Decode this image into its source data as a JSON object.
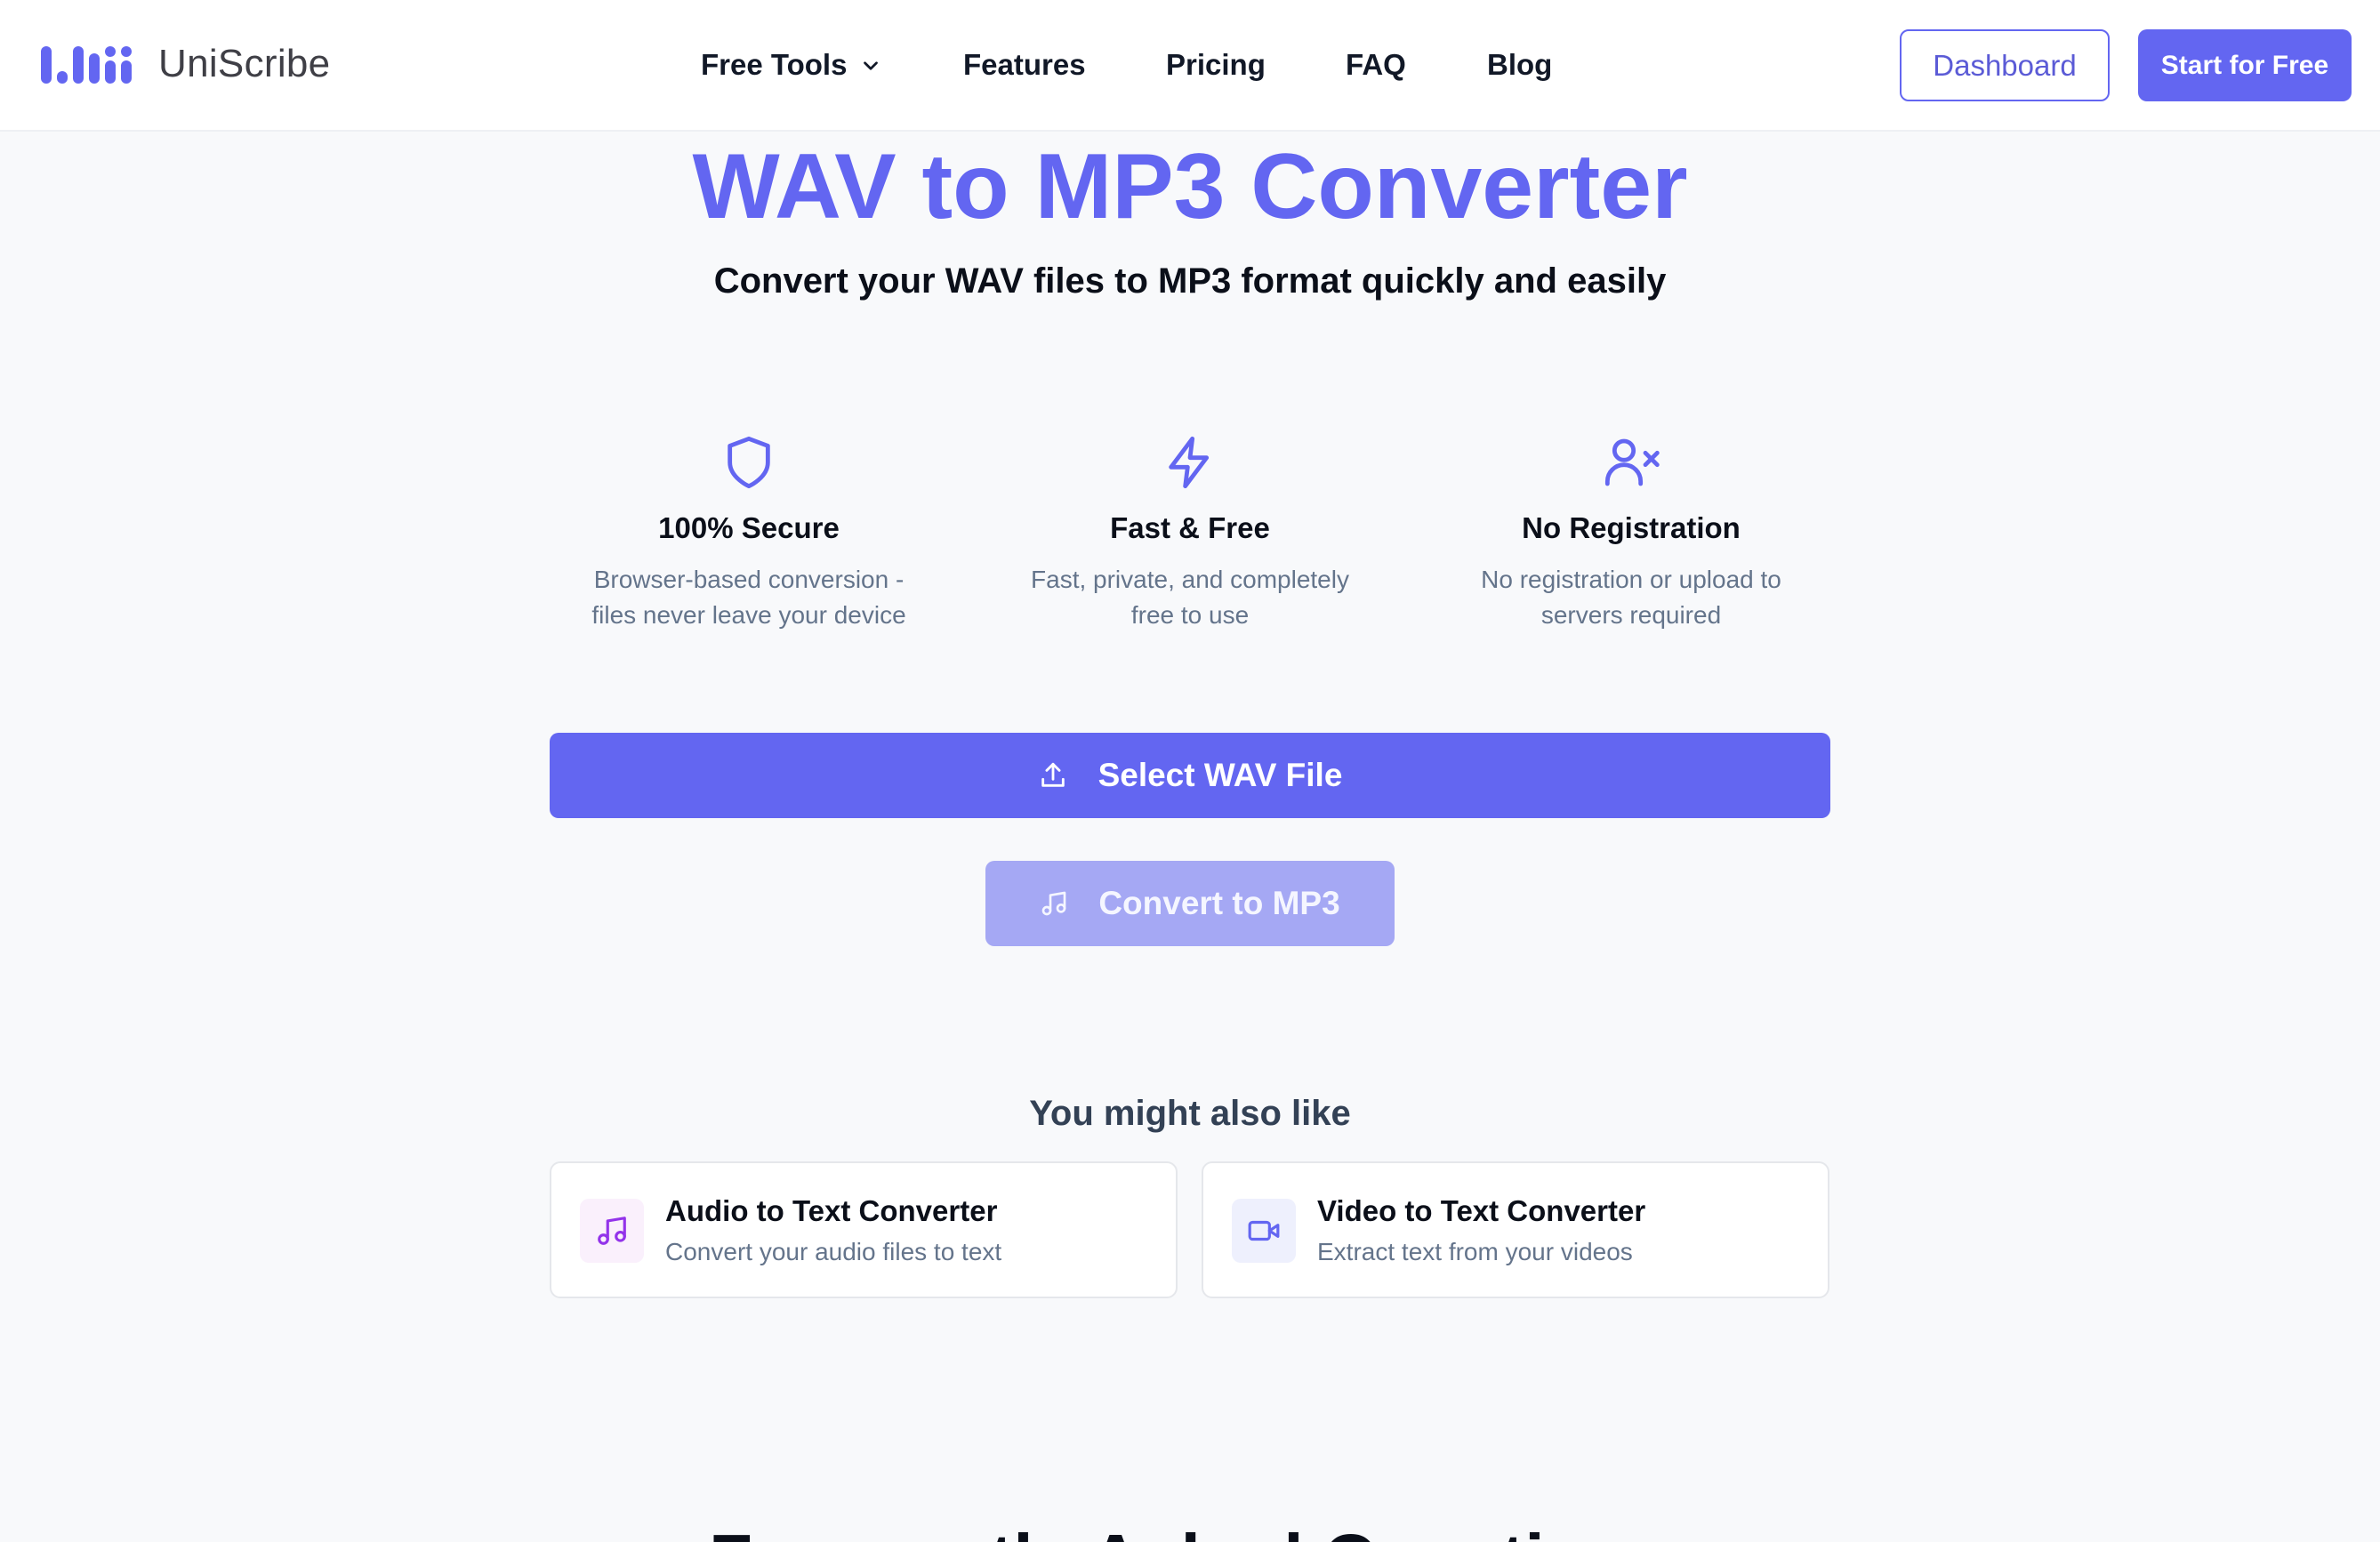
{
  "brand": {
    "name": "UniScribe",
    "accent": "#6366f1"
  },
  "nav": {
    "items": [
      {
        "label": "Free Tools"
      },
      {
        "label": "Features"
      },
      {
        "label": "Pricing"
      },
      {
        "label": "FAQ"
      },
      {
        "label": "Blog"
      }
    ],
    "dashboard_label": "Dashboard",
    "start_label": "Start for Free"
  },
  "hero": {
    "title": "WAV to MP3 Converter",
    "subtitle": "Convert your WAV files to MP3 format quickly and easily"
  },
  "features": [
    {
      "icon": "shield-icon",
      "title": "100% Secure",
      "desc_line1": "Browser-based conversion -",
      "desc_line2": "files never leave your device"
    },
    {
      "icon": "lightning-icon",
      "title": "Fast & Free",
      "desc_line1": "Fast, private, and completely",
      "desc_line2": "free to use"
    },
    {
      "icon": "user-x-icon",
      "title": "No Registration",
      "desc_line1": "No registration or upload to",
      "desc_line2": "servers required"
    }
  ],
  "actions": {
    "select_label": "Select WAV File",
    "convert_label": "Convert to MP3",
    "convert_disabled": true
  },
  "related": {
    "title": "You might also like",
    "cards": [
      {
        "icon": "music-note-icon",
        "title": "Audio to Text Converter",
        "desc": "Convert your audio files to text"
      },
      {
        "icon": "video-camera-icon",
        "title": "Video to Text Converter",
        "desc": "Extract text from your videos"
      }
    ]
  },
  "faq": {
    "heading": "Frequently Asked Questions"
  }
}
